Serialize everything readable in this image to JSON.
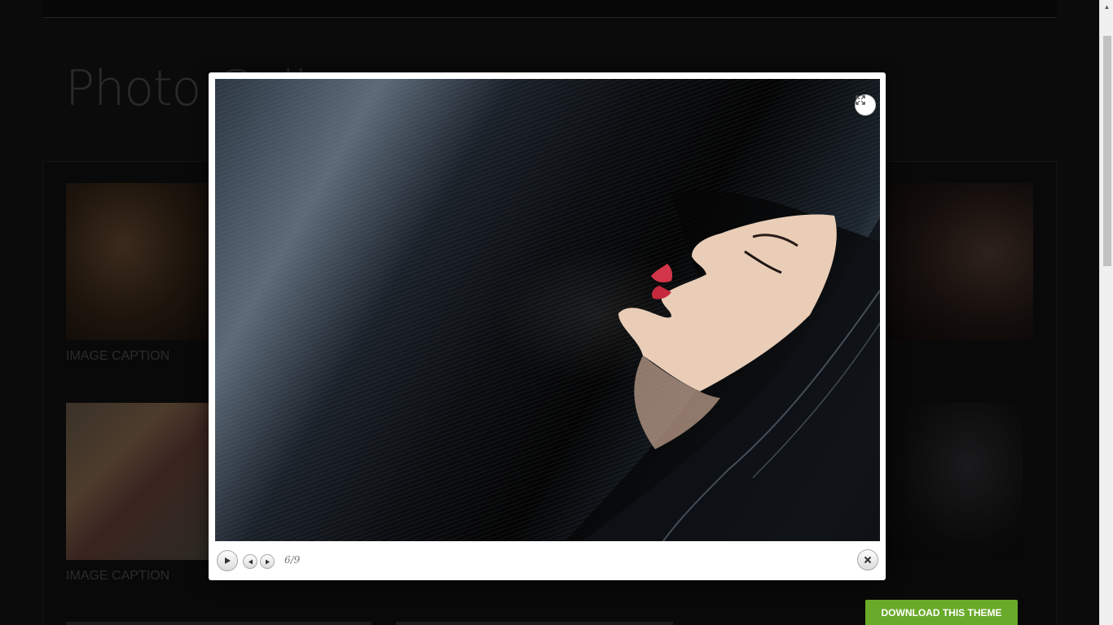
{
  "page": {
    "title": "Photo Gallery",
    "captions": [
      "IMAGE CAPTION",
      "IMAGE CAPTION"
    ]
  },
  "lightbox": {
    "counter": "6/9",
    "icons": {
      "expand": "expand-icon",
      "play": "play-icon",
      "prev": "prev-icon",
      "next": "next-icon",
      "close": "close-icon"
    }
  },
  "cta": {
    "label": "DOWNLOAD THIS THEME",
    "color": "#6aaa2a"
  }
}
